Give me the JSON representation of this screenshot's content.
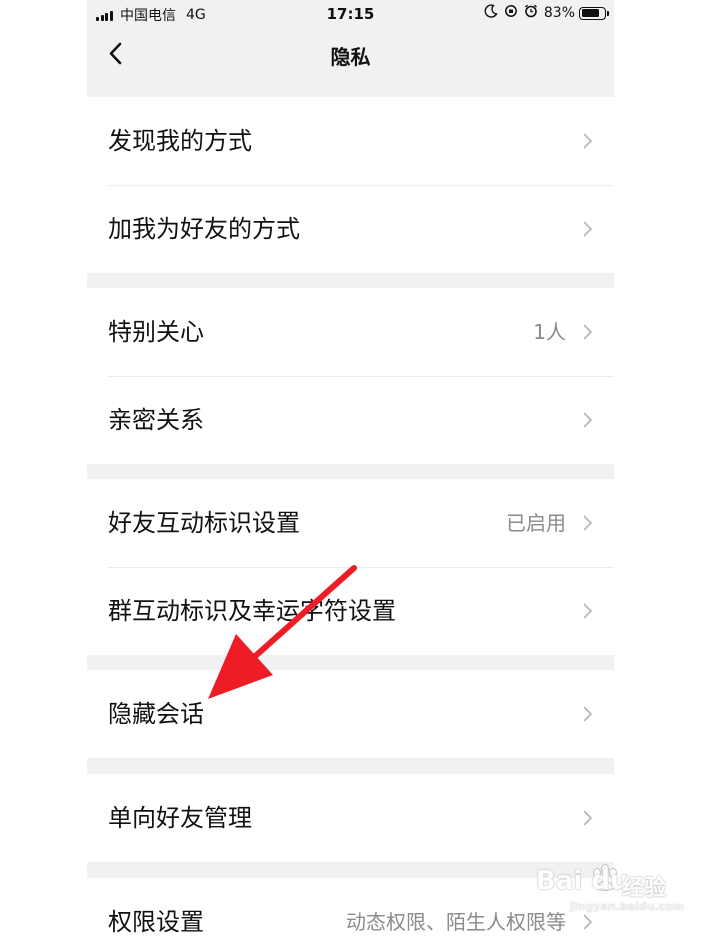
{
  "status_bar": {
    "carrier": "中国电信",
    "network": "4G",
    "time": "17:15",
    "battery": "83%",
    "battery_level": 0.83
  },
  "nav": {
    "title": "隐私",
    "back_icon": "chevron-left-icon"
  },
  "groups": [
    {
      "items": [
        {
          "label": "发现我的方式",
          "value": ""
        },
        {
          "label": "加我为好友的方式",
          "value": ""
        }
      ]
    },
    {
      "items": [
        {
          "label": "特别关心",
          "value": "1人"
        },
        {
          "label": "亲密关系",
          "value": ""
        }
      ]
    },
    {
      "items": [
        {
          "label": "好友互动标识设置",
          "value": "已启用"
        },
        {
          "label": "群互动标识及幸运字符设置",
          "value": ""
        }
      ]
    },
    {
      "items": [
        {
          "label": "隐藏会话",
          "value": ""
        }
      ]
    },
    {
      "items": [
        {
          "label": "单向好友管理",
          "value": ""
        }
      ]
    },
    {
      "items": [
        {
          "label": "权限设置",
          "value": "动态权限、陌生人权限等"
        }
      ]
    }
  ],
  "annotation": {
    "color": "#ee1c25"
  },
  "watermark": {
    "brand": "Bai du",
    "product": "经验",
    "url": "jingyan.baidu.com"
  }
}
